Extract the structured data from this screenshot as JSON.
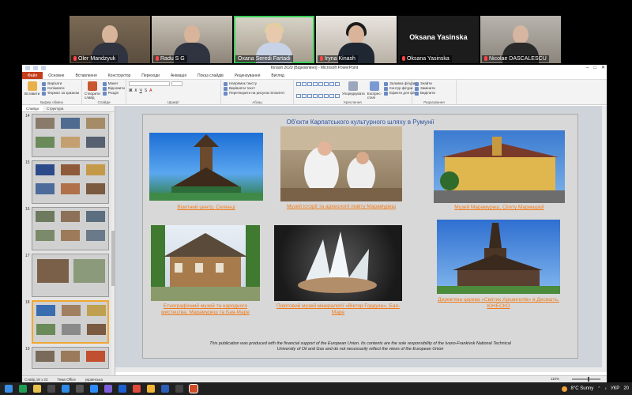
{
  "participants": [
    {
      "name": "Oleг Mandzyuk",
      "display": "Oleг Mandzyuk",
      "muted": true
    },
    {
      "name": "Radu S G",
      "display": "Radu S G",
      "muted": true
    },
    {
      "name": "Oxana Seredi Fartadi",
      "display": "Oxana Seredi Fartadi",
      "muted": false
    },
    {
      "name": "Iryna Kinash",
      "display": "Iryna Kinash",
      "muted": true
    },
    {
      "name": "Oksana Yasinska",
      "display": "Oksana Yasinska",
      "muted": true,
      "center": "Oksana Yasinska"
    },
    {
      "name": "Nicolae DASCALESCU",
      "display": "Nicolae DASCALESCU",
      "muted": true
    }
  ],
  "window": {
    "title": "Kinash 2020 [Відновлено] - Microsoft PowerPoint",
    "controls": [
      "–",
      "□",
      "✕"
    ]
  },
  "ribbon": {
    "tabs": [
      "Файл",
      "Основне",
      "Вставлення",
      "Конструктор",
      "Переходи",
      "Анімація",
      "Показ слайдів",
      "Рецензування",
      "Вигляд"
    ],
    "clipboard": {
      "paste": "Вставити",
      "cut": "Вирізати",
      "copy": "Копіювати",
      "format": "Формат за зразком",
      "group": "Буфер обміну"
    },
    "slides": {
      "new": "Створити слайд",
      "layout": "Макет",
      "reset": "Відновити",
      "section": "Розділ",
      "group": "Слайди"
    },
    "font": {
      "group": "Шрифт"
    },
    "paragraph": {
      "direction": "Напрямок тексту",
      "align": "Вирівняти текст",
      "smartart": "Перетворити на рисунок SmartArt",
      "group": "Абзац"
    },
    "drawing": {
      "arrange": "Упорядкувати",
      "styles": "Експрес-стилі",
      "fill": "Заливка фігури",
      "outline": "Контур фігури",
      "effects": "Ефекти для фігур",
      "group": "Креслення"
    },
    "editing": {
      "find": "Знайти",
      "replace": "Замінити",
      "select": "Виділити",
      "group": "Редагування"
    }
  },
  "pane": {
    "tabs": [
      "Слайди",
      "Структура"
    ],
    "thumbnails": [
      {
        "num": "14"
      },
      {
        "num": "15"
      },
      {
        "num": "16"
      },
      {
        "num": "17"
      },
      {
        "num": "18",
        "selected": true
      },
      {
        "num": "19"
      }
    ]
  },
  "slide": {
    "title": "Об'єкти Карпатського культурного шляху в Румунії",
    "items": [
      {
        "caption": "Візитний центр, Селенці"
      },
      {
        "caption": "Музей історії та археології повіту Марамуреш"
      },
      {
        "caption": "Музей Марамуреш, Сігету Мармацієй"
      },
      {
        "caption": "Етнографічний музей та народного мистецтва, Марамуреш та Бая-Маре"
      },
      {
        "caption": "Повітовий музей мінералогії «Віктор Гордуза», Бая-Маре"
      },
      {
        "caption": "Дерев'яна церква «Святих Архангелів» в Десешть, ЮНЕСКО"
      }
    ],
    "disclaimer_line1": "This publication was produced with the financial support of the European Union. Its contents are the sole responsibility of the Ivano-Frankivsk National Technical",
    "disclaimer_line2": "University of Oil and Gas and do not necessarily reflect the views of the European Union"
  },
  "statusbar": {
    "slide": "Слайд 18 з 23",
    "theme": "Тема Office",
    "lang": "українська",
    "zoom": "115%"
  },
  "taskbar": {
    "weather": "8°C  Sunny",
    "lang": "УКР",
    "time": "20"
  }
}
